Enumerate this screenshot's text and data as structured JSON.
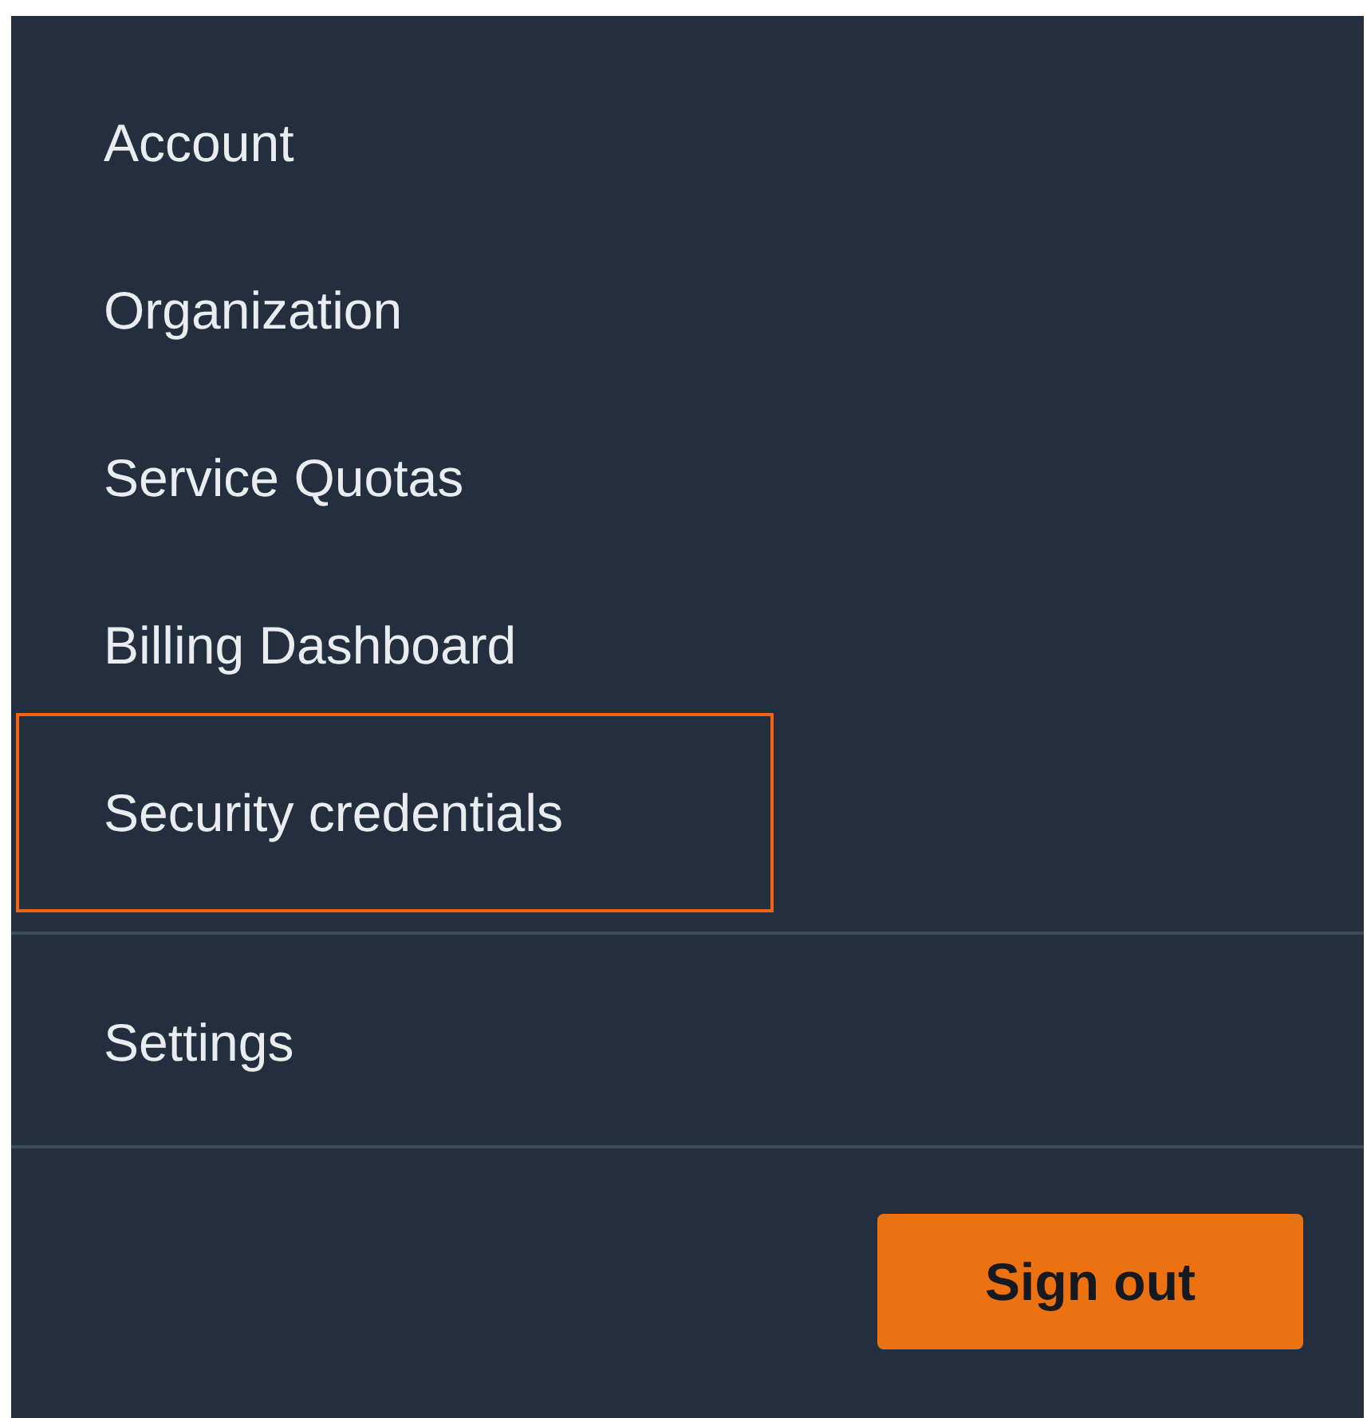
{
  "menu": {
    "groups": [
      {
        "items": [
          {
            "label": "Account",
            "highlighted": false
          },
          {
            "label": "Organization",
            "highlighted": false
          },
          {
            "label": "Service Quotas",
            "highlighted": false
          },
          {
            "label": "Billing Dashboard",
            "highlighted": false
          },
          {
            "label": "Security credentials",
            "highlighted": true
          }
        ]
      },
      {
        "items": [
          {
            "label": "Settings",
            "highlighted": false
          }
        ]
      }
    ]
  },
  "button": {
    "label": "Sign out"
  }
}
